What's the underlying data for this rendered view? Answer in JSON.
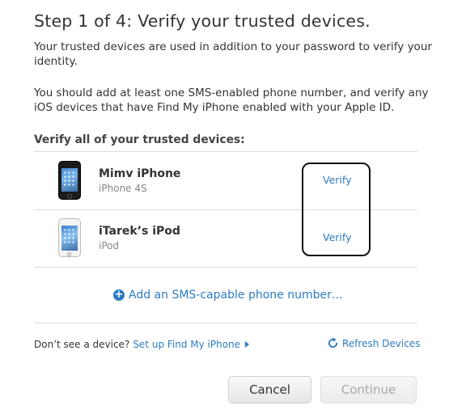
{
  "title": "Step 1 of 4: Verify your trusted devices.",
  "intro": "Your trusted devices are used in addition to your password to verify your identity.",
  "instructions": "You should add at least one SMS-enabled phone number, and verify any iOS devices that have Find My iPhone enabled with your Apple ID.",
  "section_heading": "Verify all of your trusted devices:",
  "devices": [
    {
      "name": "Mimv iPhone",
      "model": "iPhone 4S",
      "action": "Verify",
      "icon": "iphone-icon"
    },
    {
      "name": "iTarek’s iPod",
      "model": "iPod",
      "action": "Verify",
      "icon": "ipod-icon"
    }
  ],
  "add_phone_label": "Add an SMS-capable phone number…",
  "footer": {
    "missing_device_text": "Don’t see a device?",
    "setup_link": "Set up Find My iPhone",
    "refresh_label": "Refresh Devices"
  },
  "buttons": {
    "cancel": "Cancel",
    "continue": "Continue"
  },
  "colors": {
    "link": "#2d7bc4",
    "text": "#333333",
    "disabled_text": "#a8a8a8"
  }
}
